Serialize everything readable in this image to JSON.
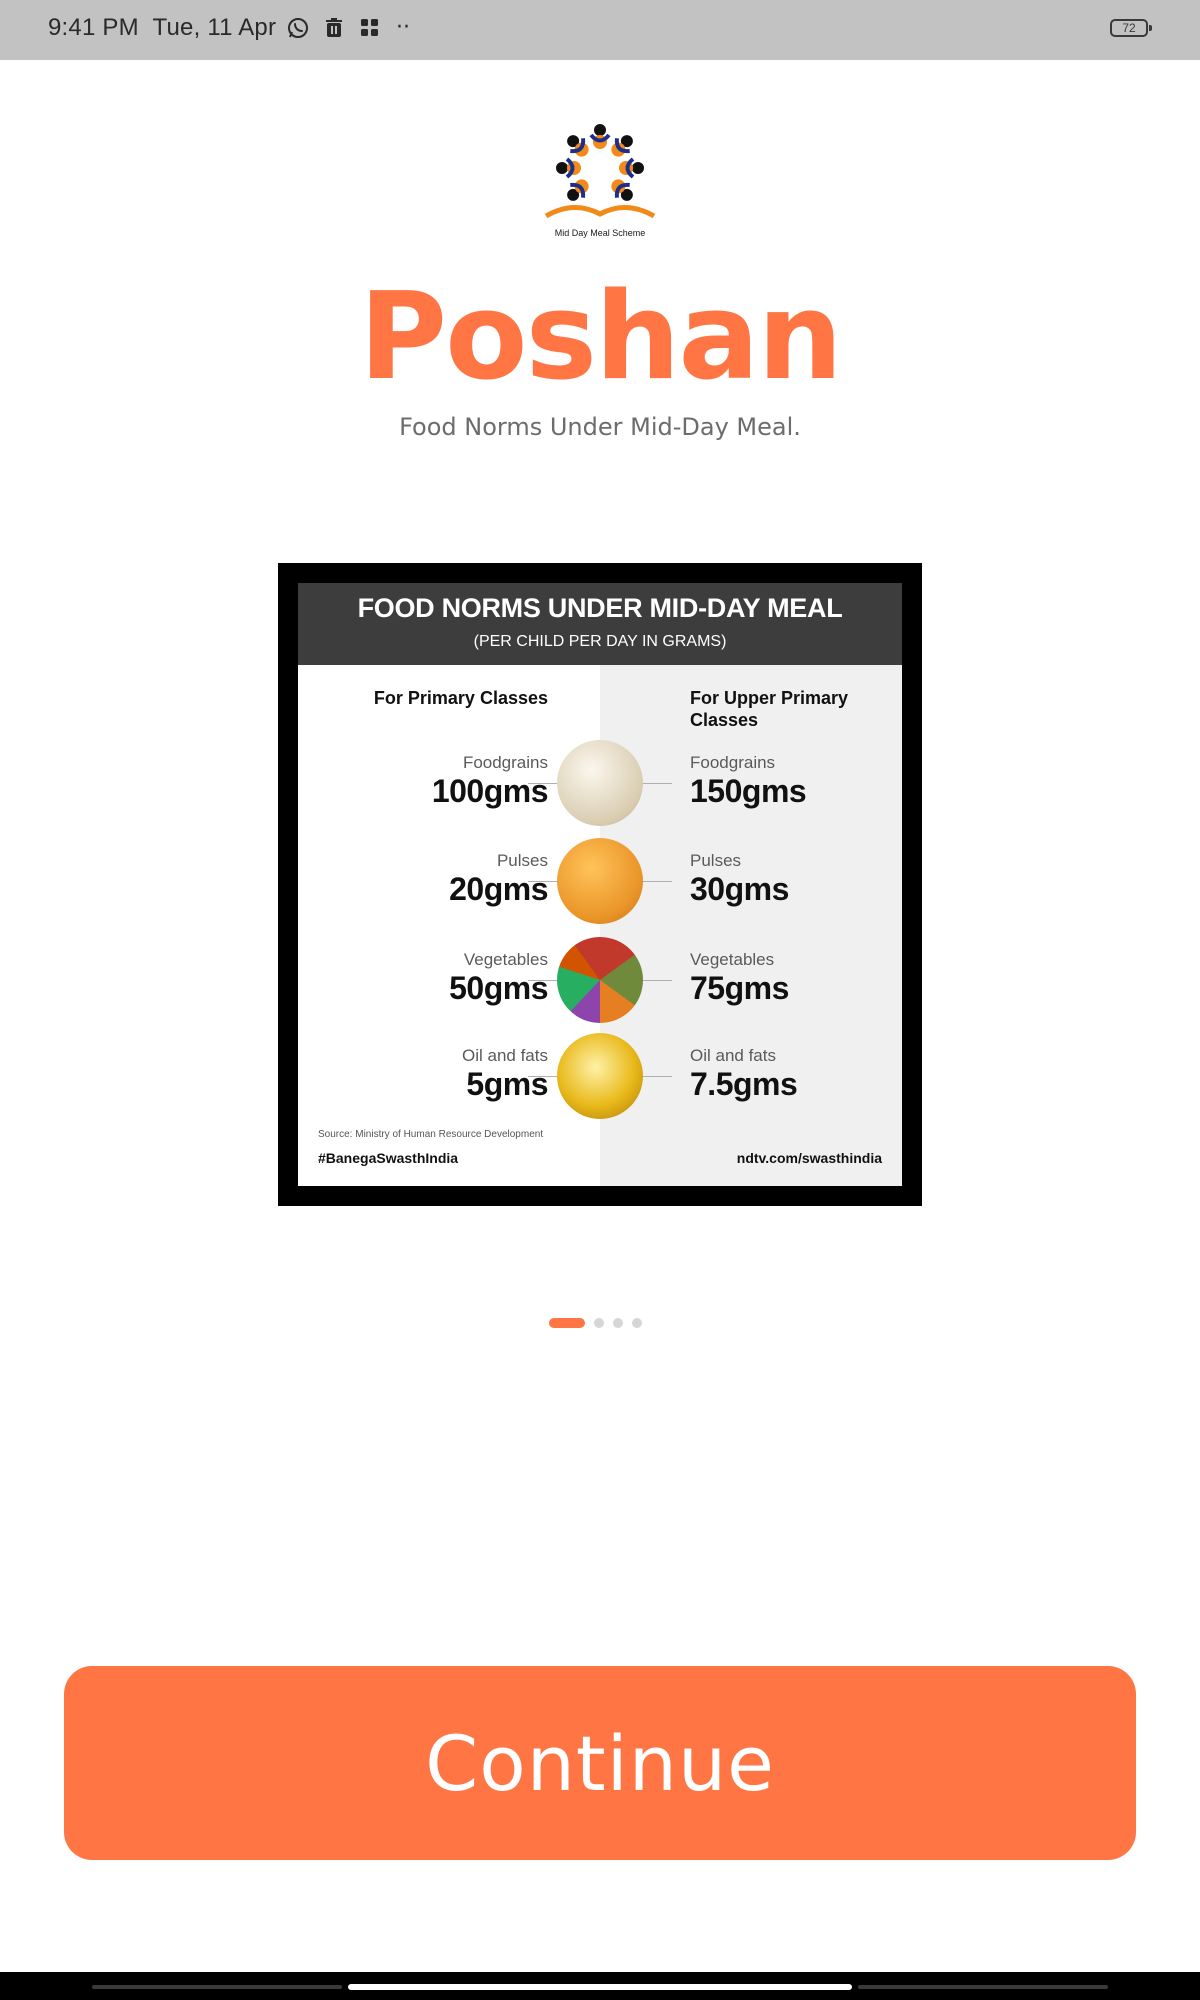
{
  "status_bar": {
    "time": "9:41 PM",
    "date": "Tue, 11 Apr",
    "icons": [
      "whatsapp-icon",
      "trash-icon",
      "apps-grid-icon"
    ],
    "more": "··",
    "battery": "72"
  },
  "header": {
    "logo_caption": "Mid Day Meal Scheme",
    "title": "Poshan",
    "subtitle": "Food Norms Under Mid-Day Meal."
  },
  "carousel": {
    "slide_count": 4,
    "active_index": 0,
    "poster": {
      "title": "FOOD NORMS UNDER MID-DAY MEAL",
      "subtitle": "(PER CHILD PER DAY IN GRAMS)",
      "left_heading": "For Primary Classes",
      "right_heading": "For Upper Primary Classes",
      "rows": [
        {
          "label": "Foodgrains",
          "primary": "100gms",
          "upper": "150gms",
          "image": "rice-grains",
          "color": "#e9dfc9"
        },
        {
          "label": "Pulses",
          "primary": "20gms",
          "upper": "30gms",
          "image": "lentils",
          "color": "#f0a43a"
        },
        {
          "label": "Vegetables",
          "primary": "50gms",
          "upper": "75gms",
          "image": "mixed-vegetables",
          "color": "#6f8a3a"
        },
        {
          "label": "Oil and fats",
          "primary": "5gms",
          "upper": "7.5gms",
          "image": "oil-bowl",
          "color": "#d9a814"
        }
      ],
      "source": "Source: Ministry of Human Resource Development",
      "hashtag": "#BanegaSwasthIndia",
      "website": "ndtv.com/swasthindia"
    }
  },
  "actions": {
    "continue_label": "Continue"
  },
  "colors": {
    "accent": "#ff7544",
    "status_bar": "#c2c2c2",
    "subtitle": "#6c6c6c"
  }
}
